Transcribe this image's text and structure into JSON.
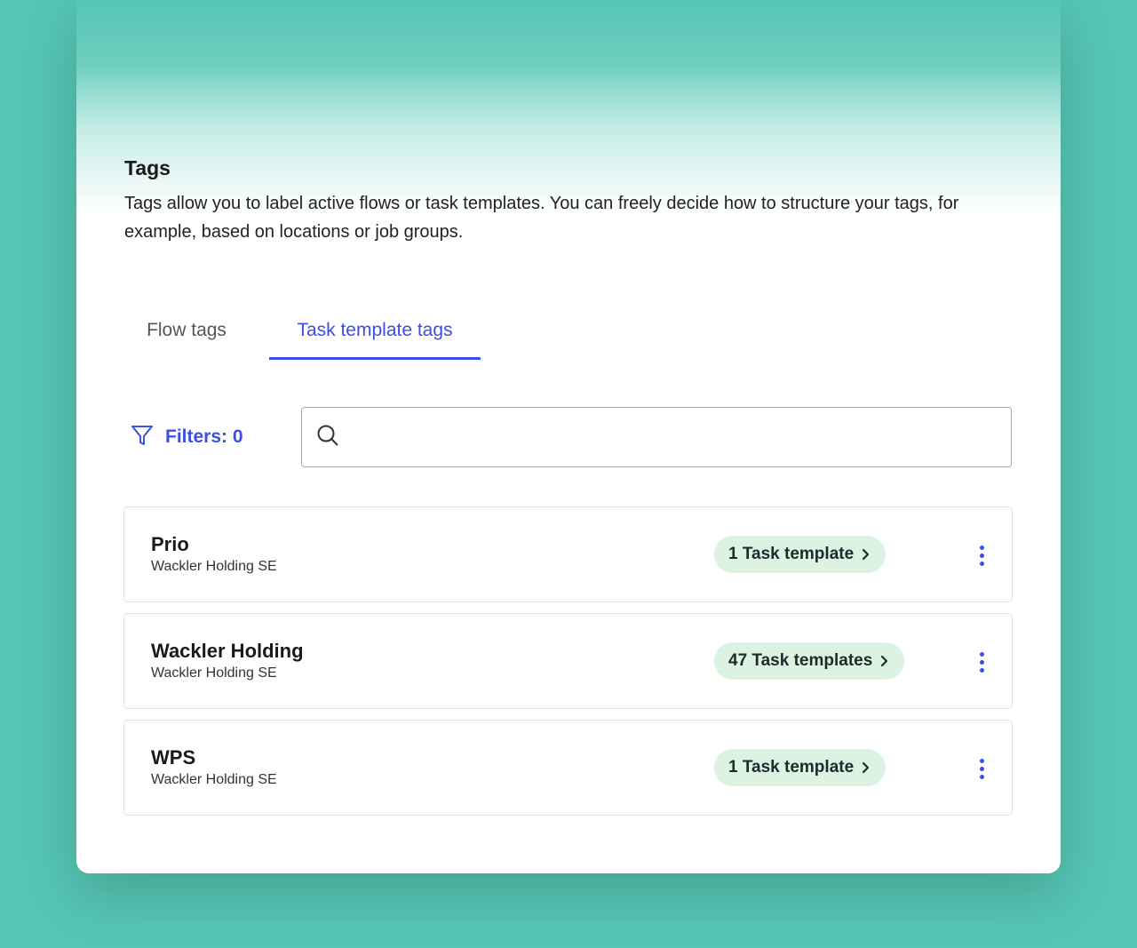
{
  "page": {
    "title": "Tags",
    "description": "Tags allow you to label active flows or task templates. You can freely decide how to structure your tags, for example, based on locations or job groups."
  },
  "tabs": [
    {
      "label": "Flow tags",
      "active": false
    },
    {
      "label": "Task template tags",
      "active": true
    }
  ],
  "toolbar": {
    "filters_label": "Filters: 0",
    "search_placeholder": ""
  },
  "tags": [
    {
      "name": "Prio",
      "company": "Wackler Holding SE",
      "count_label": "1 Task template"
    },
    {
      "name": "Wackler Holding",
      "company": "Wackler Holding SE",
      "count_label": "47 Task templates"
    },
    {
      "name": "WPS",
      "company": "Wackler Holding SE",
      "count_label": "1 Task template"
    }
  ],
  "colors": {
    "background": "#55c6b4",
    "accent": "#3a4fe6",
    "pill": "#dcf3e1"
  },
  "icons": {
    "filter": "filter-icon",
    "search": "search-icon",
    "chevron": "chevron-right-icon",
    "menu": "more-vertical-icon"
  }
}
